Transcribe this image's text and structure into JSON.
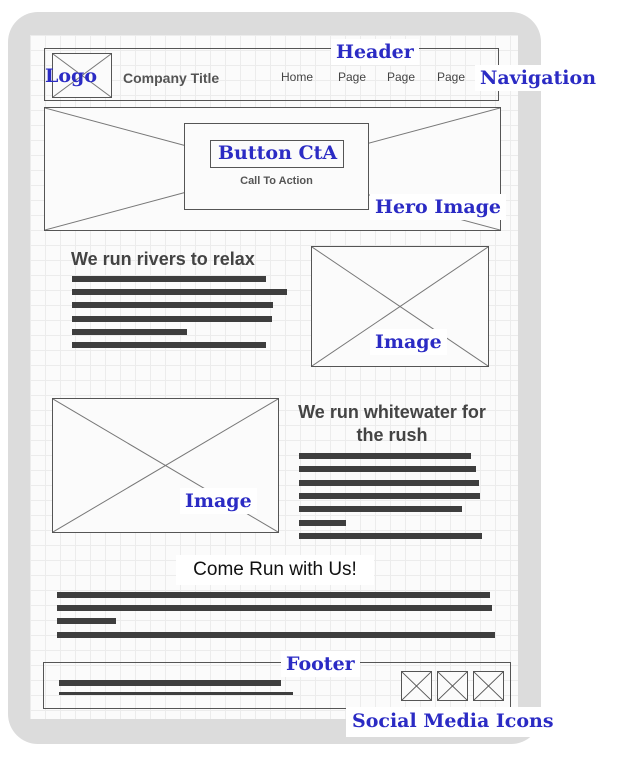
{
  "header": {
    "logo_label": "Logo",
    "company_title": "Company Title",
    "nav_items": [
      "Home",
      "Page",
      "Page",
      "Page"
    ]
  },
  "hero": {
    "cta_button_label": "Button CtA",
    "cta_caption": "Call To Action"
  },
  "sections": {
    "section1_heading": "We run rivers to relax",
    "section2_heading": "We run whitewater for the rush",
    "closing_heading": "Come Run with Us!"
  },
  "annotations": {
    "header": "Header",
    "logo": "Logo",
    "navigation": "Navigation",
    "hero_image": "Hero Image",
    "image_1": "Image",
    "image_2": "Image",
    "footer": "Footer",
    "social_media_icons": "Social Media Icons"
  },
  "colors": {
    "annotation_text": "#2b2bc4",
    "placeholder_bars": "#3e3e3e",
    "frame": "#dcdcdc"
  }
}
